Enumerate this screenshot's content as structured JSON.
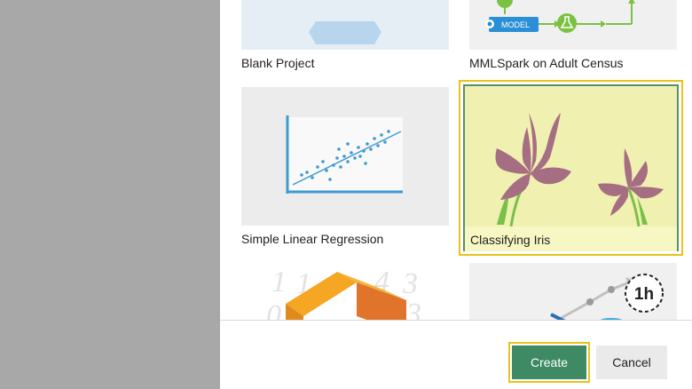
{
  "templates": [
    {
      "label": "Blank Project"
    },
    {
      "label": "MMLSpark on Adult Census",
      "diagram_label": "MODEL"
    },
    {
      "label": "Simple Linear Regression"
    },
    {
      "label": "Classifying Iris"
    },
    {
      "label": ""
    },
    {
      "label": "",
      "timer_label": "1h"
    }
  ],
  "footer": {
    "create_label": "Create",
    "cancel_label": "Cancel"
  },
  "colors": {
    "accent": "#3d8a64",
    "selection": "#e8c31a",
    "backdrop": "#a8a8a8"
  }
}
